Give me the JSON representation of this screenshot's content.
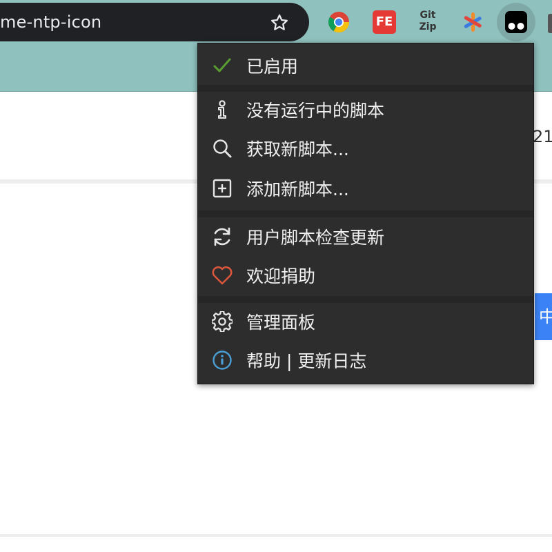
{
  "browser": {
    "address_text": "me-ntp-icon",
    "extensions": [
      {
        "icon": "chrome-icon"
      },
      {
        "icon": "fe-helper-icon",
        "label": "FE"
      },
      {
        "icon": "gitzip-icon",
        "label_top": "Git",
        "label_bottom": "Zip"
      },
      {
        "icon": "asterisk-extension-icon"
      },
      {
        "icon": "tampermonkey-icon"
      }
    ]
  },
  "page": {
    "side_number": "21",
    "side_button_text": "中删"
  },
  "menu": {
    "items": [
      {
        "id": "enabled",
        "label": "已启用",
        "icon": "checkmark-icon"
      },
      {
        "id": "no-scripts",
        "label": "没有运行中的脚本",
        "icon": "info-i-icon"
      },
      {
        "id": "get-scripts",
        "label": "获取新脚本...",
        "icon": "search-icon"
      },
      {
        "id": "add-script",
        "label": "添加新脚本...",
        "icon": "plus-square-icon"
      },
      {
        "id": "check-updates",
        "label": "用户脚本检查更新",
        "icon": "refresh-icon"
      },
      {
        "id": "donate",
        "label": "欢迎捐助",
        "icon": "heart-icon"
      },
      {
        "id": "dashboard",
        "label": "管理面板",
        "icon": "gear-icon"
      },
      {
        "id": "help",
        "label": "帮助 | 更新日志",
        "icon": "info-circle-icon"
      }
    ]
  },
  "colors": {
    "toolbar_bg": "#8fc1be",
    "menu_bg": "#2d2d2d",
    "check_green": "#5a9e32",
    "heart_red": "#d9553b",
    "info_blue": "#4a9fd6"
  }
}
